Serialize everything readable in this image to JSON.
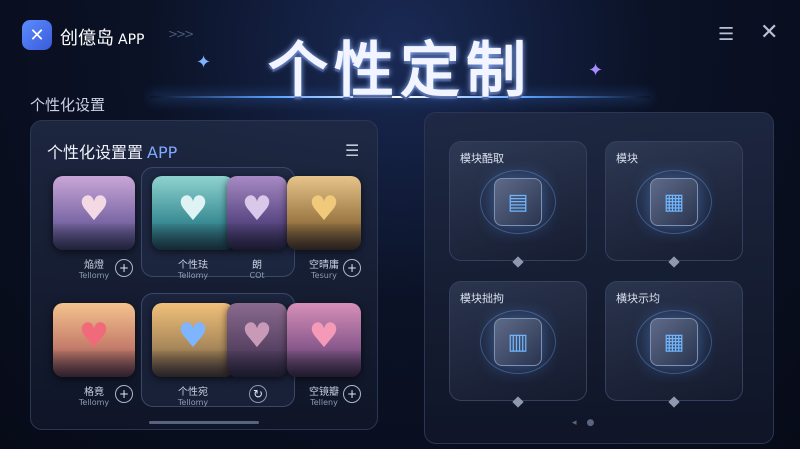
{
  "app": {
    "name": "创億岛",
    "suffix": "APP"
  },
  "hero": {
    "title": "个性定制"
  },
  "section_label": "个性化设置",
  "left_panel": {
    "header": "个性化设置置",
    "header_accent": "APP",
    "themes": [
      {
        "label": "焔燈",
        "sub": "Tellomy",
        "colors": [
          "#c9a6d8",
          "#7e6aa8",
          "#3b3d66"
        ],
        "heart": "#f3d9e3"
      },
      {
        "label": "个性珐",
        "sub": "Tellomy",
        "colors": [
          "#8fd3d0",
          "#3d8f97",
          "#1f4d5c"
        ],
        "heart": "#dff3f4"
      },
      {
        "label": "朗",
        "sub": "COt",
        "colors": [
          "#a88ac4",
          "#5d4a86",
          "#2c2a4e"
        ],
        "heart": "#d9c8ea"
      },
      {
        "label": "空晴庸",
        "sub": "Tesury",
        "colors": [
          "#e6c48a",
          "#9e7a46",
          "#4a3a2a"
        ],
        "heart": "#f0c97a"
      },
      {
        "label": "格竟",
        "sub": "Tellomy",
        "colors": [
          "#f4c38e",
          "#c47d6a",
          "#5a3a48"
        ],
        "heart": "#f06a7a"
      },
      {
        "label": "个性宛",
        "sub": "Tellomy",
        "colors": [
          "#f1c07a",
          "#a8885a",
          "#4a3e3a"
        ],
        "heart": "#7fb4ff"
      },
      {
        "label": "",
        "sub": "",
        "colors": [
          "#8a6a8e",
          "#5a4466",
          "#2e2a44"
        ],
        "heart": "#c99ab8"
      },
      {
        "label": "空镜瓣",
        "sub": "Telleny",
        "colors": [
          "#d68fb8",
          "#8a5a8c",
          "#3a2e4e"
        ],
        "heart": "#f49ab8"
      }
    ]
  },
  "right_panel": {
    "modules": [
      {
        "label": "模块酷取",
        "glyph": "▤"
      },
      {
        "label": "模块",
        "glyph": "▦"
      },
      {
        "label": "模块拙拘",
        "glyph": "▥"
      },
      {
        "label": "横块示均",
        "glyph": "▦"
      }
    ]
  },
  "icons": {
    "logo": "app-logo-icon",
    "edit": "edit-list-icon",
    "close": "close-icon",
    "menu": "menu-list-icon",
    "plus": "plus-icon",
    "refresh": "refresh-icon"
  }
}
